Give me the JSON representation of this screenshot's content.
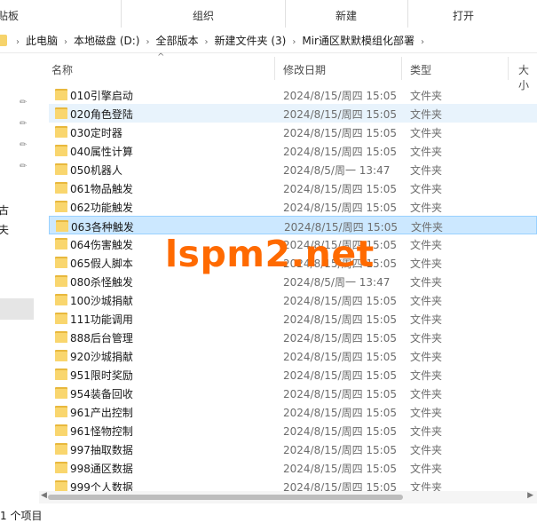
{
  "ribbon": {
    "groups": [
      "贴板",
      "组织",
      "新建",
      "打开"
    ]
  },
  "address": {
    "crumbs": [
      "此电脑",
      "本地磁盘 (D:)",
      "全部版本",
      "新建文件夹 (3)",
      "Mir通区默默模组化部署"
    ],
    "separator": "›"
  },
  "nav": {
    "pin_icon": "pin-icon",
    "chars": [
      "古",
      "夫"
    ]
  },
  "columns": {
    "name": "名称",
    "modified": "修改日期",
    "type": "类型",
    "size": "大小",
    "sort_caret": "^"
  },
  "files": [
    {
      "name": "010引擎启动",
      "date": "2024/8/15/周四 15:05",
      "type": "文件夹",
      "state": ""
    },
    {
      "name": "020角色登陆",
      "date": "2024/8/15/周四 15:05",
      "type": "文件夹",
      "state": "hover"
    },
    {
      "name": "030定时器",
      "date": "2024/8/15/周四 15:05",
      "type": "文件夹",
      "state": ""
    },
    {
      "name": "040属性计算",
      "date": "2024/8/15/周四 15:05",
      "type": "文件夹",
      "state": ""
    },
    {
      "name": "050机器人",
      "date": "2024/8/5/周一 13:47",
      "type": "文件夹",
      "state": ""
    },
    {
      "name": "061物品触发",
      "date": "2024/8/15/周四 15:05",
      "type": "文件夹",
      "state": ""
    },
    {
      "name": "062功能触发",
      "date": "2024/8/15/周四 15:05",
      "type": "文件夹",
      "state": ""
    },
    {
      "name": "063各种触发",
      "date": "2024/8/15/周四 15:05",
      "type": "文件夹",
      "state": "selected"
    },
    {
      "name": "064伤害触发",
      "date": "2024/8/15/周四 15:05",
      "type": "文件夹",
      "state": ""
    },
    {
      "name": "065假人脚本",
      "date": "2024/8/15/周四 15:05",
      "type": "文件夹",
      "state": ""
    },
    {
      "name": "080杀怪触发",
      "date": "2024/8/5/周一 13:47",
      "type": "文件夹",
      "state": ""
    },
    {
      "name": "100沙城捐献",
      "date": "2024/8/15/周四 15:05",
      "type": "文件夹",
      "state": ""
    },
    {
      "name": "111功能调用",
      "date": "2024/8/15/周四 15:05",
      "type": "文件夹",
      "state": ""
    },
    {
      "name": "888后台管理",
      "date": "2024/8/15/周四 15:05",
      "type": "文件夹",
      "state": ""
    },
    {
      "name": "920沙城捐献",
      "date": "2024/8/15/周四 15:05",
      "type": "文件夹",
      "state": ""
    },
    {
      "name": "951限时奖励",
      "date": "2024/8/15/周四 15:05",
      "type": "文件夹",
      "state": ""
    },
    {
      "name": "954装备回收",
      "date": "2024/8/15/周四 15:05",
      "type": "文件夹",
      "state": ""
    },
    {
      "name": "961产出控制",
      "date": "2024/8/15/周四 15:05",
      "type": "文件夹",
      "state": ""
    },
    {
      "name": "961怪物控制",
      "date": "2024/8/15/周四 15:05",
      "type": "文件夹",
      "state": ""
    },
    {
      "name": "997抽取数据",
      "date": "2024/8/15/周四 15:05",
      "type": "文件夹",
      "state": ""
    },
    {
      "name": "998通区数据",
      "date": "2024/8/15/周四 15:05",
      "type": "文件夹",
      "state": ""
    },
    {
      "name": "999个人数据",
      "date": "2024/8/15/周四 15:05",
      "type": "文件夹",
      "state": ""
    }
  ],
  "folder_icon": "folder-icon",
  "colors": {
    "folder_front": "#f9d66e",
    "folder_back": "#e8b83d",
    "selection_bg": "#cce8ff",
    "selection_border": "#99d1ff",
    "hover_bg": "#e8f3fc",
    "watermark": "#ff6a00"
  },
  "watermark": "lspm2.net",
  "status": {
    "text": "1 个项目"
  }
}
